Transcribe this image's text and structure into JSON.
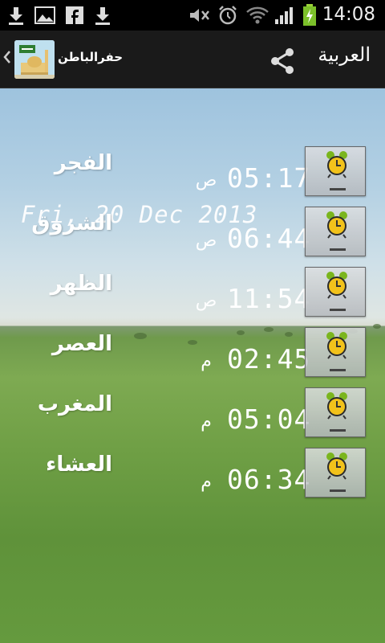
{
  "status_bar": {
    "time": "14:08",
    "icons": [
      "download-icon",
      "image-icon",
      "facebook-icon",
      "download-icon",
      "mute-icon",
      "alarm-icon",
      "wifi-icon",
      "signal-icon",
      "battery-charging-icon"
    ]
  },
  "action_bar": {
    "title": "حفرالباطن",
    "language_button": "العربية",
    "icons": [
      "back-chevron-icon",
      "app-icon",
      "share-icon"
    ]
  },
  "date": "Fri, 20 Dec 2013",
  "prayers": [
    {
      "name": "الفجر",
      "time": "05:17",
      "period": "ص"
    },
    {
      "name": "الشروق",
      "time": "06:44",
      "period": "ص"
    },
    {
      "name": "الظهر",
      "time": "11:54",
      "period": "ص"
    },
    {
      "name": "العصر",
      "time": "02:45",
      "period": "م"
    },
    {
      "name": "المغرب",
      "time": "05:04",
      "period": "م"
    },
    {
      "name": "العشاء",
      "time": "06:34",
      "period": "م"
    }
  ],
  "colors": {
    "accent_alarm": "#f2c21b",
    "alarm_bells": "#7ab51d"
  }
}
